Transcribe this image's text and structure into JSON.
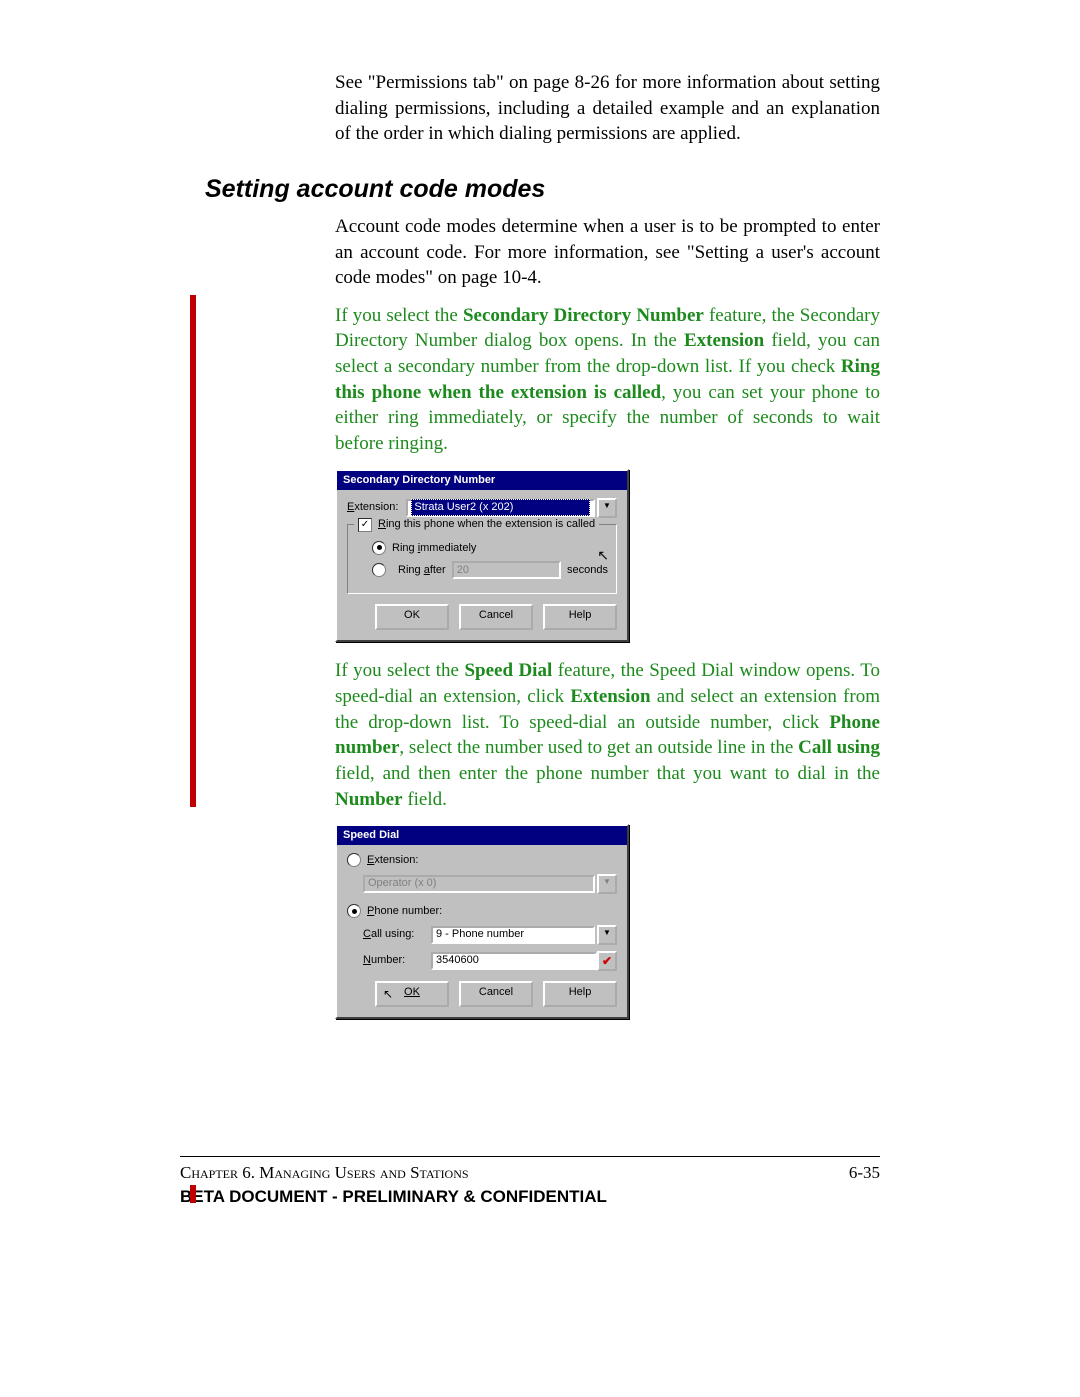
{
  "intro": {
    "p1": "See \"Permissions tab\" on page 8-26 for more information about setting dialing permissions, including a detailed example and an explanation of the order in which dialing permissions are applied."
  },
  "heading1": "Setting account code modes",
  "section1": {
    "p1": "Account code modes determine when a user is to be prompted to enter an account code. For more information, see \"Setting a user's account code modes\" on page 10-4.",
    "green_a": "If you select the ",
    "green_b": "Secondary Directory Number",
    "green_c": " feature, the Secondary Directory Number dialog box opens. In the ",
    "green_d": "Extension",
    "green_e": " field, you can select a secondary number from the drop-down list. If you check ",
    "green_f": "Ring this phone when the extension is called",
    "green_g": ", you can set your phone to either ring immediately, or specify the number of seconds to wait before ringing."
  },
  "dialog1": {
    "title": "Secondary Directory Number",
    "ext_label": "Extension:",
    "ext_value": "Strata User2 (x 202)",
    "check_label": "Ring this phone when the extension is called",
    "radio1": "Ring immediately",
    "radio2_a": "Ring after",
    "radio2_val": "20",
    "radio2_b": "seconds",
    "ok": "OK",
    "cancel": "Cancel",
    "help": "Help"
  },
  "section2": {
    "a": "If you select the ",
    "b": "Speed Dial",
    "c": " feature, the Speed Dial window opens. To speed-dial an extension, click ",
    "d": "Extension",
    "e": " and select an extension from the drop-down list. To speed-dial an outside number, click ",
    "f": "Phone number",
    "g": ", select the number used to get an outside line in the ",
    "h": "Call using",
    "i": " field, and then enter the phone number that you want to dial in the ",
    "j": "Number",
    "k": " field."
  },
  "dialog2": {
    "title": "Speed Dial",
    "radio_ext": "Extension:",
    "ext_disabled": "Operator (x 0)",
    "radio_phone": "Phone number:",
    "call_lbl": "Call using:",
    "call_val": "9 - Phone number",
    "num_lbl": "Number:",
    "num_val": "3540600",
    "ok": "OK",
    "cancel": "Cancel",
    "help": "Help"
  },
  "footer": {
    "chapter": "Chapter 6. Managing Users and Stations",
    "page": "6-35",
    "conf": "BETA DOCUMENT - PRELIMINARY & CONFIDENTIAL"
  }
}
